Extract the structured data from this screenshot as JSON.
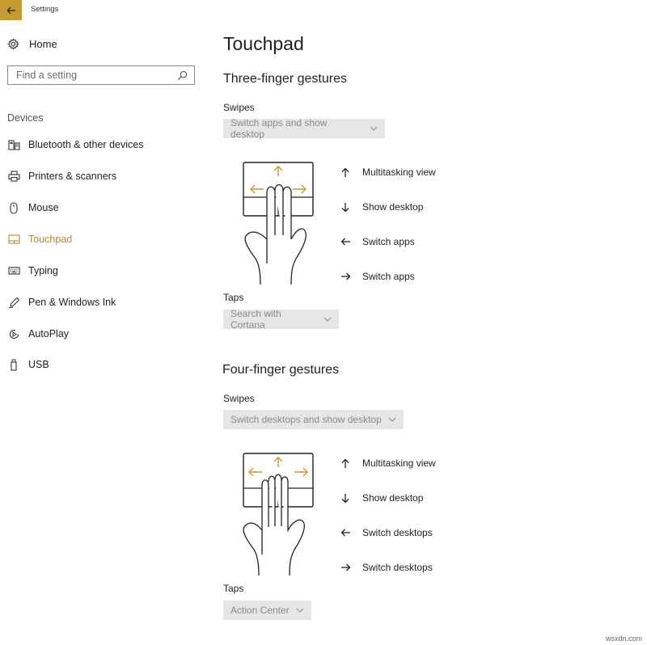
{
  "window": {
    "title": "Settings"
  },
  "sidebar": {
    "home_label": "Home",
    "search_placeholder": "Find a setting",
    "section_label": "Devices",
    "items": [
      {
        "label": "Bluetooth & other devices",
        "icon": "bluetooth-devices-icon"
      },
      {
        "label": "Printers & scanners",
        "icon": "printer-icon"
      },
      {
        "label": "Mouse",
        "icon": "mouse-icon"
      },
      {
        "label": "Touchpad",
        "icon": "touchpad-icon",
        "active": true
      },
      {
        "label": "Typing",
        "icon": "keyboard-icon"
      },
      {
        "label": "Pen & Windows Ink",
        "icon": "pen-icon"
      },
      {
        "label": "AutoPlay",
        "icon": "autoplay-icon"
      },
      {
        "label": "USB",
        "icon": "usb-icon"
      }
    ]
  },
  "main": {
    "title": "Touchpad",
    "three_finger": {
      "heading": "Three-finger gestures",
      "swipes_label": "Swipes",
      "swipes_value": "Switch apps and show desktop",
      "gestures": [
        {
          "direction": "up",
          "label": "Multitasking view"
        },
        {
          "direction": "down",
          "label": "Show desktop"
        },
        {
          "direction": "left",
          "label": "Switch apps"
        },
        {
          "direction": "right",
          "label": "Switch apps"
        }
      ],
      "taps_label": "Taps",
      "taps_value": "Search with Cortana"
    },
    "four_finger": {
      "heading": "Four-finger gestures",
      "swipes_label": "Swipes",
      "swipes_value": "Switch desktops and show desktop",
      "gestures": [
        {
          "direction": "up",
          "label": "Multitasking view"
        },
        {
          "direction": "down",
          "label": "Show desktop"
        },
        {
          "direction": "left",
          "label": "Switch desktops"
        },
        {
          "direction": "right",
          "label": "Switch desktops"
        }
      ],
      "taps_label": "Taps",
      "taps_value": "Action Center"
    }
  },
  "watermark": "wsxdn.com",
  "colors": {
    "accent": "#c69a2e",
    "active_text": "#b88a25",
    "dropdown_bg": "#e6e6e6"
  }
}
